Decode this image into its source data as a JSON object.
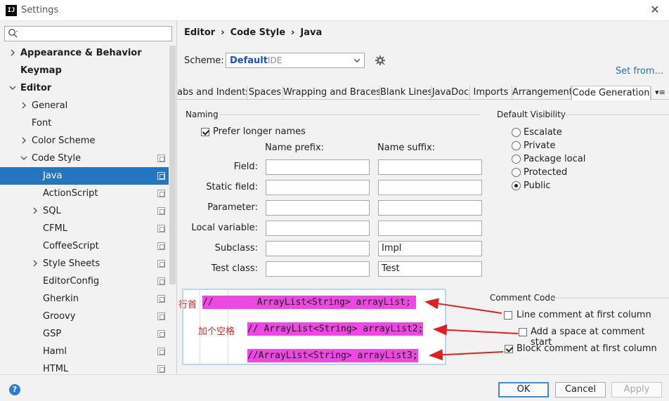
{
  "window": {
    "title": "Settings",
    "app_icon": "IJ"
  },
  "search": {
    "placeholder": ""
  },
  "tree": [
    {
      "label": "Appearance & Behavior",
      "level": 0,
      "chevron": true,
      "bold": true
    },
    {
      "label": "Keymap",
      "level": 0,
      "chevron": false,
      "bold": true
    },
    {
      "label": "Editor",
      "level": 0,
      "chevron": true,
      "expanded": true,
      "bold": true
    },
    {
      "label": "General",
      "level": 1,
      "chevron": true
    },
    {
      "label": "Font",
      "level": 1,
      "chevron": false
    },
    {
      "label": "Color Scheme",
      "level": 1,
      "chevron": true
    },
    {
      "label": "Code Style",
      "level": 1,
      "chevron": true,
      "expanded": true,
      "copy": true
    },
    {
      "label": "Java",
      "level": 2,
      "selected": true,
      "copy": true
    },
    {
      "label": "ActionScript",
      "level": 2,
      "copy": true
    },
    {
      "label": "SQL",
      "level": 2,
      "chevron": true,
      "copy": true
    },
    {
      "label": "CFML",
      "level": 2,
      "copy": true
    },
    {
      "label": "CoffeeScript",
      "level": 2,
      "copy": true
    },
    {
      "label": "Style Sheets",
      "level": 2,
      "chevron": true,
      "copy": true
    },
    {
      "label": "EditorConfig",
      "level": 2,
      "copy": true
    },
    {
      "label": "Gherkin",
      "level": 2,
      "copy": true
    },
    {
      "label": "Groovy",
      "level": 2,
      "copy": true
    },
    {
      "label": "GSP",
      "level": 2,
      "copy": true
    },
    {
      "label": "Haml",
      "level": 2,
      "copy": true
    },
    {
      "label": "HTML",
      "level": 2,
      "copy": true
    }
  ],
  "breadcrumb": [
    "Editor",
    "Code Style",
    "Java"
  ],
  "scheme": {
    "label": "Scheme:",
    "name": "Default",
    "kind": "IDE",
    "set_from": "Set from..."
  },
  "tabs": [
    "abs and Indents",
    "Spaces",
    "Wrapping and Braces",
    "Blank Lines",
    "JavaDoc",
    "Imports",
    "Arrangement",
    "Code Generation"
  ],
  "active_tab": "Code Generation",
  "naming": {
    "title": "Naming",
    "prefer_longer": "Prefer longer names",
    "prefix_header": "Name prefix:",
    "suffix_header": "Name suffix:",
    "rows": [
      {
        "label": "Field:",
        "prefix": "",
        "suffix": ""
      },
      {
        "label": "Static field:",
        "prefix": "",
        "suffix": ""
      },
      {
        "label": "Parameter:",
        "prefix": "",
        "suffix": ""
      },
      {
        "label": "Local variable:",
        "prefix": "",
        "suffix": ""
      },
      {
        "label": "Subclass:",
        "prefix": "",
        "suffix": "Impl"
      },
      {
        "label": "Test class:",
        "prefix": "",
        "suffix": "Test"
      }
    ]
  },
  "visibility": {
    "title": "Default Visibility",
    "options": [
      "Escalate",
      "Private",
      "Package local",
      "Protected",
      "Public"
    ],
    "selected": "Public"
  },
  "comment_code": {
    "title": "Comment Code",
    "options": [
      {
        "label": "Line comment at first column",
        "checked": false
      },
      {
        "label": "Add a space at comment start",
        "checked": false
      },
      {
        "label": "Block comment at first column",
        "checked": true
      }
    ]
  },
  "preview": {
    "line1_prefix": "//",
    "line1_code": "ArrayList<String> arrayList;",
    "line2": "// ArrayList<String> arrayList2;",
    "line3": "//ArrayList<String> arrayList3;",
    "annot1": "行首",
    "annot2": "加个空格"
  },
  "buttons": {
    "ok": "OK",
    "cancel": "Cancel",
    "apply": "Apply",
    "help": "?"
  },
  "colors": {
    "selection": "#2675bf",
    "highlight": "#ef47e3",
    "arrow": "#e02020",
    "link": "#2470b3"
  }
}
